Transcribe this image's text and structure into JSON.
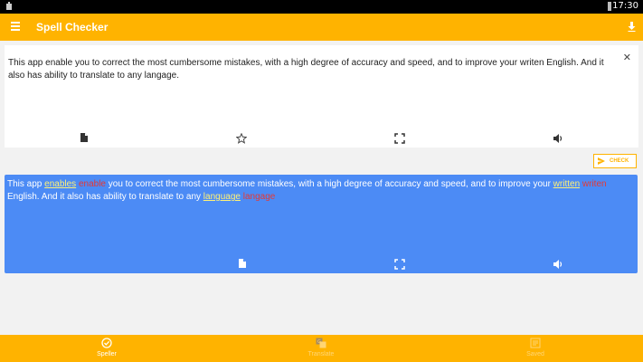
{
  "status_bar": {
    "time": "17:30"
  },
  "app_bar": {
    "title": "Spell Checker"
  },
  "input": {
    "text": "This app enable you to correct the most cumbersome mistakes, with a high degree of accuracy and speed, and to improve your writen English. And it also has ability to translate to any langage.",
    "toolbar_icons": [
      "copy-icon",
      "star-icon",
      "fullscreen-icon",
      "speaker-icon"
    ]
  },
  "check_button": {
    "label": "CHECK"
  },
  "result": {
    "segments": [
      {
        "t": "This app ",
        "k": "plain"
      },
      {
        "t": "enables",
        "k": "err"
      },
      {
        "t": " enable",
        "k": "sug"
      },
      {
        "t": "  you to correct the most cumbersome mistakes, with a high degree of accuracy and speed, and to improve your ",
        "k": "plain"
      },
      {
        "t": "written",
        "k": "err"
      },
      {
        "t": " writen",
        "k": "sug"
      },
      {
        "t": " English. And it also has ability to translate to any ",
        "k": "plain"
      },
      {
        "t": "language",
        "k": "err"
      },
      {
        "t": " langage",
        "k": "sug"
      }
    ],
    "toolbar_icons": [
      "copy-icon",
      "fullscreen-icon",
      "speaker-icon"
    ]
  },
  "bottom_nav": {
    "items": [
      {
        "label": "Speller",
        "icon": "check-circle-icon",
        "active": true
      },
      {
        "label": "Translate",
        "icon": "translate-icon",
        "active": false
      },
      {
        "label": "Saved",
        "icon": "bookmark-list-icon",
        "active": false
      }
    ]
  },
  "colors": {
    "accent": "#ffb300",
    "result_bg": "#4c8bf5",
    "error_word": "#fff176",
    "original_word": "#e53935"
  }
}
